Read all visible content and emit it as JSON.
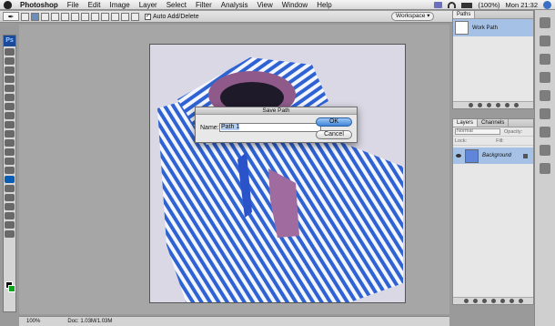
{
  "menubar": {
    "app_name": "Photoshop",
    "items": [
      "File",
      "Edit",
      "Image",
      "Layer",
      "Select",
      "Filter",
      "Analysis",
      "View",
      "Window",
      "Help"
    ],
    "battery": "(100%)",
    "clock": "Mon 21:32"
  },
  "options": {
    "auto_add_delete_label": "Auto Add/Delete",
    "workspace_label": "Workspace ▾"
  },
  "toolbox": {
    "logo": "Ps"
  },
  "dialog": {
    "title": "Save Path",
    "name_label": "Name:",
    "name_value_highlight": "Path 1",
    "ok_label": "OK",
    "cancel_label": "Cancel"
  },
  "paths_panel": {
    "tab": "Paths",
    "items": [
      {
        "label": "Work Path"
      }
    ]
  },
  "layers_panel": {
    "tabs": [
      "Layers",
      "Channels"
    ],
    "blend_mode": "Normal",
    "opacity_label": "Opacity:",
    "lock_label": "Lock:",
    "fill_label": "Fill:",
    "layer_name": "Background"
  },
  "statusbar": {
    "zoom": "100%",
    "doc_info": "Doc: 1.03M/1.03M"
  },
  "colors": {
    "foreground": "#0d0d0d",
    "background": "#0aa61e",
    "selection": "#a5c2e6",
    "shirt_stripe": "#2f63d3"
  }
}
